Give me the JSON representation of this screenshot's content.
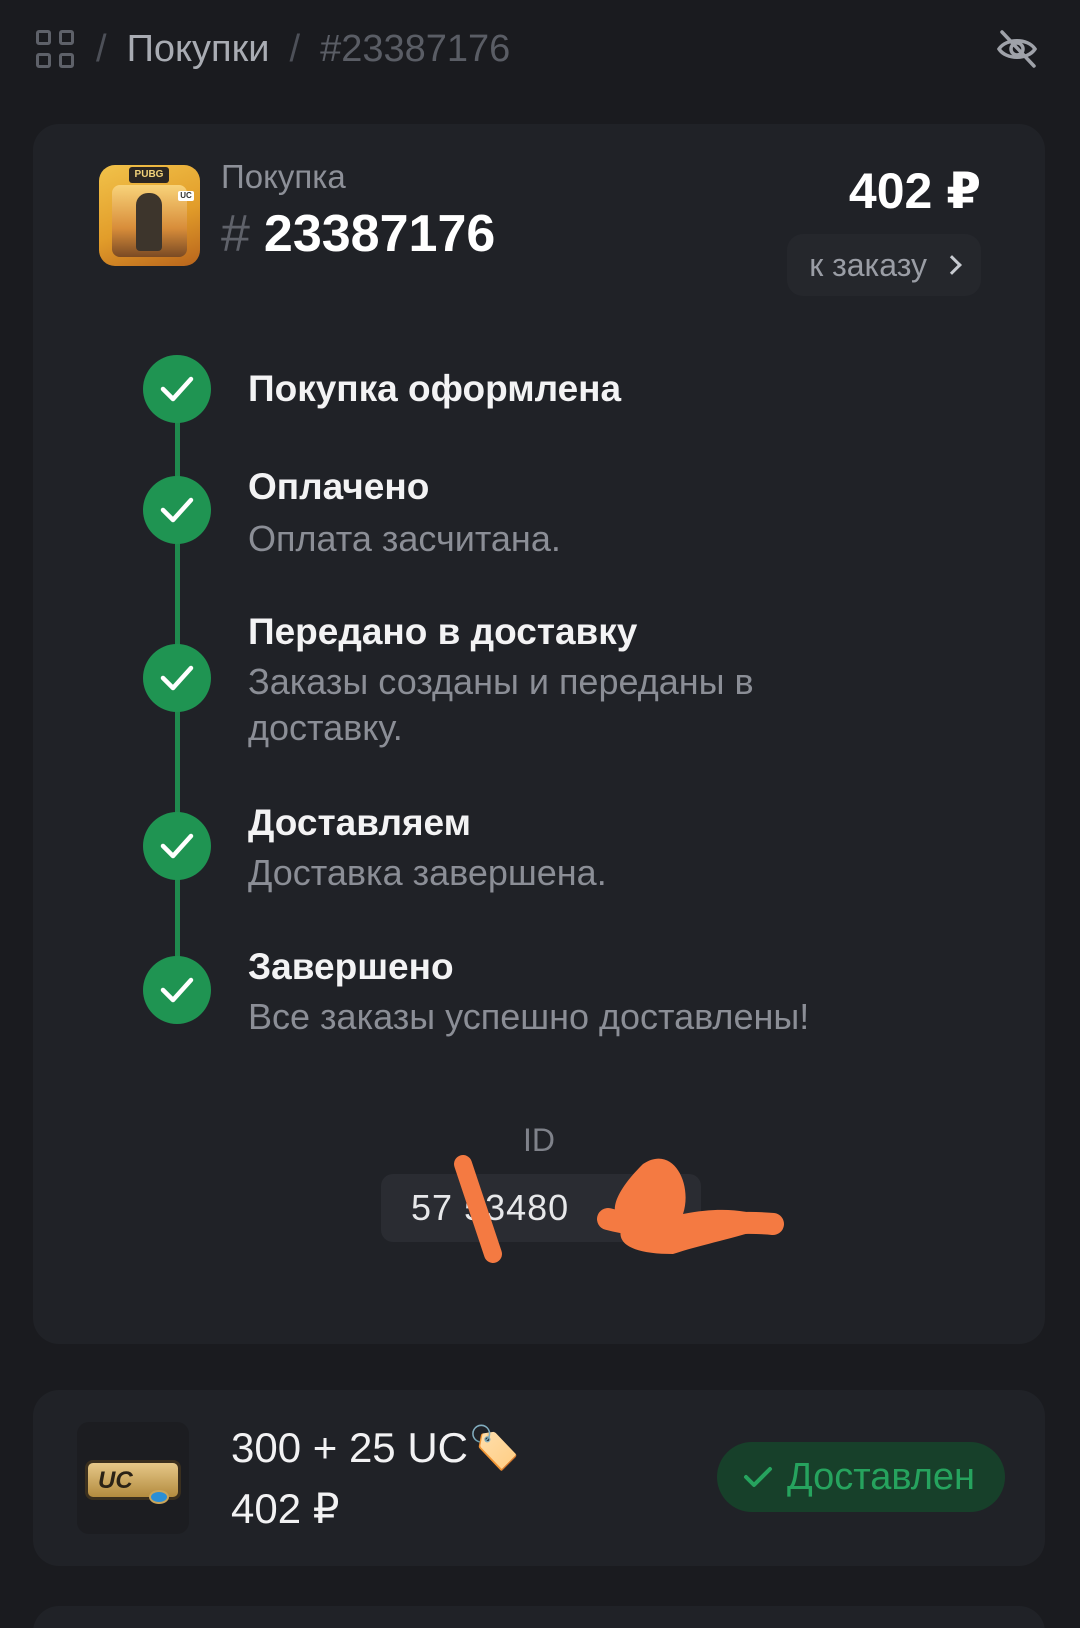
{
  "breadcrumb": {
    "section": "Покупки",
    "current": "#23387176"
  },
  "purchase": {
    "label": "Покупка",
    "hash": "#",
    "number": "23387176",
    "price": "402 ₽",
    "to_order_label": "к заказу"
  },
  "steps": [
    {
      "title": "Покупка оформлена",
      "desc": ""
    },
    {
      "title": "Оплачено",
      "desc": "Оплата засчитана."
    },
    {
      "title": "Передано в доставку",
      "desc": "Заказы созданы и переданы в доставку."
    },
    {
      "title": "Доставляем",
      "desc": "Доставка завершена."
    },
    {
      "title": "Завершено",
      "desc": "Все заказы успешно доставлены!"
    }
  ],
  "id_block": {
    "label": "ID",
    "value": "57 53480"
  },
  "product": {
    "title": "300 + 25 UC🏷️",
    "price": "402 ₽",
    "status": "Доставлен"
  },
  "colors": {
    "background": "#1a1b1f",
    "card": "#202227",
    "accent_green": "#1f9452",
    "status_green": "#26a35e",
    "scribble": "#f47a42"
  },
  "icons": [
    "grid-icon",
    "eye-off-icon",
    "chevron-right-icon",
    "check-icon",
    "pubg-game-icon",
    "uc-pack-icon"
  ]
}
